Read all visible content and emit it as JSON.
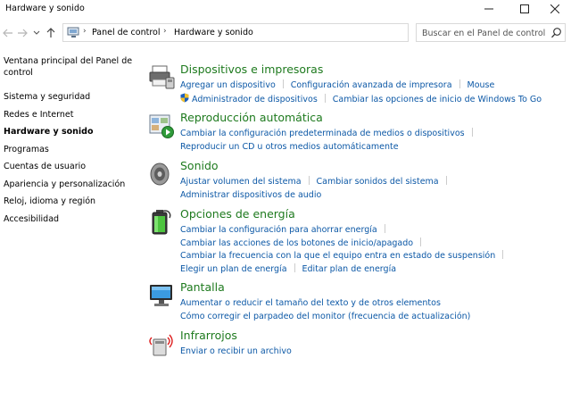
{
  "window": {
    "title": "Hardware y sonido"
  },
  "address": {
    "crumbs": [
      "Panel de control",
      "Hardware y sonido"
    ],
    "search_placeholder": "Buscar en el Panel de control"
  },
  "sidebar": {
    "items": [
      {
        "label": "Ventana principal del Panel de control"
      },
      {
        "label": "Sistema y seguridad"
      },
      {
        "label": "Redes e Internet"
      },
      {
        "label": "Hardware y sonido"
      },
      {
        "label": "Programas"
      },
      {
        "label": "Cuentas de usuario"
      },
      {
        "label": "Apariencia y personalización"
      },
      {
        "label": "Reloj, idioma y región"
      },
      {
        "label": "Accesibilidad"
      }
    ]
  },
  "categories": [
    {
      "title": "Dispositivos e impresoras",
      "icon": "printer-icon",
      "lines": [
        [
          "Agregar un dispositivo",
          "Configuración avanzada de impresora",
          "Mouse"
        ],
        [
          "Administrador de dispositivos",
          "Cambiar las opciones de inicio de Windows To Go"
        ]
      ]
    },
    {
      "title": "Reproducción automática",
      "icon": "autoplay-icon",
      "lines": [
        [
          "Cambiar la configuración predeterminada de medios o dispositivos"
        ],
        [
          "Reproducir un CD u otros medios automáticamente"
        ]
      ]
    },
    {
      "title": "Sonido",
      "icon": "speaker-icon",
      "lines": [
        [
          "Ajustar volumen del sistema",
          "Cambiar sonidos del sistema"
        ],
        [
          "Administrar dispositivos de audio"
        ]
      ]
    },
    {
      "title": "Opciones de energía",
      "icon": "battery-icon",
      "lines": [
        [
          "Cambiar la configuración para ahorrar energía"
        ],
        [
          "Cambiar las acciones de los botones de inicio/apagado"
        ],
        [
          "Cambiar la frecuencia con la que el equipo entra en estado de suspensión"
        ],
        [
          "Elegir un plan de energía",
          "Editar plan de energía"
        ]
      ]
    },
    {
      "title": "Pantalla",
      "icon": "monitor-icon",
      "lines": [
        [
          "Aumentar o reducir el tamaño del texto y de otros elementos"
        ],
        [
          "Cómo corregir el parpadeo del monitor (frecuencia de actualización)"
        ]
      ]
    },
    {
      "title": "Infrarrojos",
      "icon": "infrared-icon",
      "lines": [
        [
          "Enviar o recibir un archivo"
        ]
      ]
    }
  ],
  "colors": {
    "category_title": "#1e7a1e",
    "link": "#0c58a6"
  }
}
